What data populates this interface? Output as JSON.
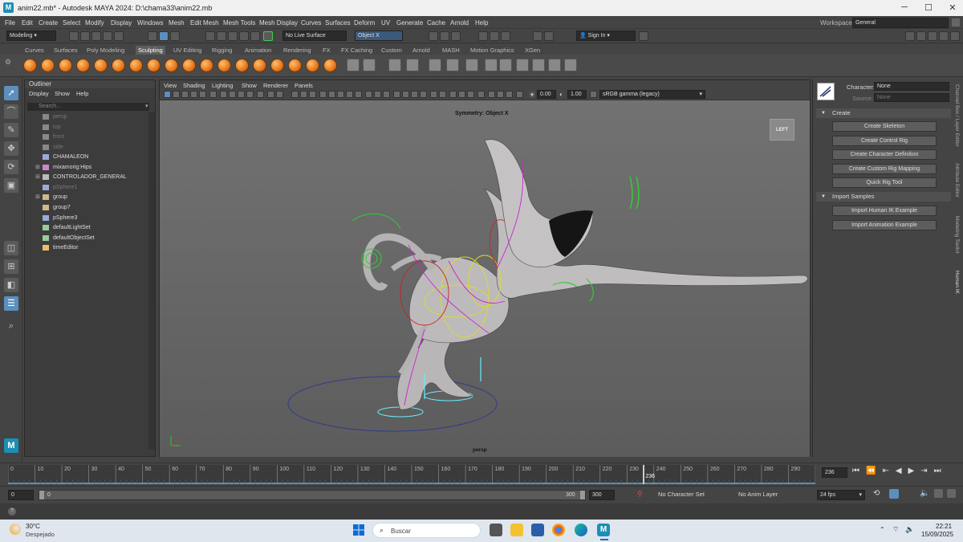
{
  "window": {
    "title": "anim22.mb* - Autodesk MAYA 2024: D:\\chama33\\anim22.mb",
    "logo": "M"
  },
  "menu": [
    "File",
    "Edit",
    "Create",
    "Select",
    "Modify",
    "Display",
    "Windows",
    "Mesh",
    "Edit Mesh",
    "Mesh Tools",
    "Mesh Display",
    "Curves",
    "Surfaces",
    "Deform",
    "UV",
    "Generate",
    "Cache",
    "Arnold",
    "Help"
  ],
  "workspace": {
    "label": "Workspace:",
    "value": "General"
  },
  "statusline": {
    "mode": "Modeling",
    "live_surface": "No Live Surface",
    "object_field": "Object X",
    "sign_in": "Sign In"
  },
  "shelf_tabs": [
    "Curves",
    "Surfaces",
    "Poly Modeling",
    "Sculpting",
    "UV Editing",
    "Rigging",
    "Animation",
    "Rendering",
    "FX",
    "FX Caching",
    "Custom",
    "Arnold",
    "MASH",
    "Motion Graphics",
    "XGen"
  ],
  "shelf_active": "Sculpting",
  "outliner": {
    "title": "Outliner",
    "menu": [
      "Display",
      "Show",
      "Help"
    ],
    "search_placeholder": "Search...",
    "items": [
      {
        "label": "persp",
        "dim": true,
        "expand": false,
        "icon": "camera-icon"
      },
      {
        "label": "top",
        "dim": true,
        "expand": false,
        "icon": "camera-icon"
      },
      {
        "label": "front",
        "dim": true,
        "expand": false,
        "icon": "camera-icon"
      },
      {
        "label": "side",
        "dim": true,
        "expand": false,
        "icon": "camera-icon"
      },
      {
        "label": "CHAMALEON",
        "dim": false,
        "expand": false,
        "icon": "mesh-icon"
      },
      {
        "label": "mixamorig:Hips",
        "dim": false,
        "expand": true,
        "icon": "joint-icon"
      },
      {
        "label": "CONTROLADOR_GENERAL",
        "dim": false,
        "expand": true,
        "icon": "curve-icon"
      },
      {
        "label": "pSphere1",
        "dim": true,
        "expand": false,
        "icon": "mesh-icon"
      },
      {
        "label": "group",
        "dim": false,
        "expand": true,
        "icon": "group-icon"
      },
      {
        "label": "group7",
        "dim": false,
        "expand": false,
        "icon": "group-icon"
      },
      {
        "label": "pSphere3",
        "dim": false,
        "expand": false,
        "icon": "mesh-icon"
      },
      {
        "label": "defaultLightSet",
        "dim": false,
        "expand": false,
        "icon": "set-icon"
      },
      {
        "label": "defaultObjectSet",
        "dim": false,
        "expand": false,
        "icon": "set-icon"
      },
      {
        "label": "timeEditor",
        "dim": false,
        "expand": false,
        "icon": "time-icon"
      }
    ]
  },
  "viewport": {
    "menu": [
      "View",
      "Shading",
      "Lighting",
      "Show",
      "Renderer",
      "Panels"
    ],
    "exposure": "0.00",
    "gamma": "1.00",
    "colorspace": "sRGB gamma (legacy)",
    "symmetry": "Symmetry: Object X",
    "viewcube": "LEFT",
    "camera": "persp"
  },
  "human_ik": {
    "character_label": "Character:",
    "character_value": "None",
    "source_label": "Source:",
    "source_value": "None",
    "create_section": "Create",
    "create_buttons": [
      "Create Skeleton",
      "Create Control Rig",
      "Create Character Definition",
      "Create Custom Rig Mapping",
      "Quick Rig Tool"
    ],
    "import_section": "Import Samples",
    "import_buttons": [
      "Import Human IK Example",
      "Import Animation Example"
    ]
  },
  "side_tabs": [
    "Channel Box / Layer Editor",
    "Attribute Editor",
    "Modeling Toolkit",
    "Human IK"
  ],
  "timeline": {
    "ticks": [
      "0",
      "10",
      "20",
      "30",
      "40",
      "50",
      "60",
      "70",
      "80",
      "90",
      "100",
      "110",
      "120",
      "130",
      "140",
      "150",
      "160",
      "170",
      "180",
      "190",
      "200",
      "210",
      "220",
      "230",
      "240",
      "250",
      "260",
      "270",
      "280",
      "290"
    ],
    "current_frame": "236",
    "current_field": "236"
  },
  "range": {
    "start": "0",
    "inner_start": "0",
    "inner_end": "300",
    "end": "300",
    "character_set": "No Character Set",
    "anim_layer": "No Anim Layer",
    "fps": "24 fps"
  },
  "taskbar": {
    "temp": "30°C",
    "weather": "Despejado",
    "search": "Buscar",
    "time": "22:21",
    "date": "15/09/2025"
  }
}
